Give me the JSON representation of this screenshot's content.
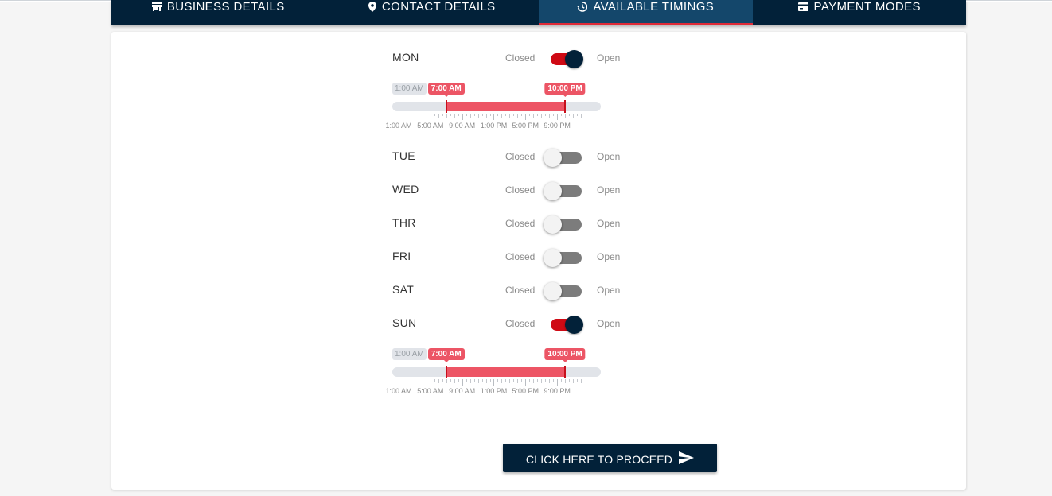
{
  "tabs": [
    {
      "label": "BUSINESS DETAILS",
      "icon": "store-icon",
      "active": false
    },
    {
      "label": "CONTACT DETAILS",
      "icon": "location-pin-icon",
      "active": false
    },
    {
      "label": "AVAILABLE TIMINGS",
      "icon": "history-clock-icon",
      "active": true
    },
    {
      "label": "PAYMENT MODES",
      "icon": "payment-card-icon",
      "active": false
    }
  ],
  "toggle_labels": {
    "closed": "Closed",
    "open": "Open"
  },
  "days": [
    {
      "name": "MON",
      "open": true
    },
    {
      "name": "TUE",
      "open": false
    },
    {
      "name": "WED",
      "open": false
    },
    {
      "name": "THR",
      "open": false
    },
    {
      "name": "FRI",
      "open": false
    },
    {
      "name": "SAT",
      "open": false
    },
    {
      "name": "SUN",
      "open": true
    }
  ],
  "sliders": [
    {
      "day": "MON",
      "min_label": "1:00 AM",
      "from_label": "7:00 AM",
      "to_label": "10:00 PM",
      "from_hour": 7,
      "to_hour": 22
    },
    {
      "day": "SUN",
      "min_label": "1:00 AM",
      "from_label": "7:00 AM",
      "to_label": "10:00 PM",
      "from_hour": 7,
      "to_hour": 22
    }
  ],
  "slider_range": {
    "min_hour": 1,
    "max_hour": 24
  },
  "grid_labels": [
    {
      "label": "1:00 AM",
      "hour": 1
    },
    {
      "label": "5:00 AM",
      "hour": 5
    },
    {
      "label": "9:00 AM",
      "hour": 9
    },
    {
      "label": "1:00 PM",
      "hour": 13
    },
    {
      "label": "5:00 PM",
      "hour": 17
    },
    {
      "label": "9:00 PM",
      "hour": 21
    }
  ],
  "proceed_button": {
    "label": "CLICK HERE TO PROCEED",
    "icon": "send-icon"
  },
  "colors": {
    "navy": "#022139",
    "active_tab": "#14476b",
    "accent_red": "#e12b38",
    "range": "#ed5565",
    "toggle_on": "#cf0a14"
  }
}
